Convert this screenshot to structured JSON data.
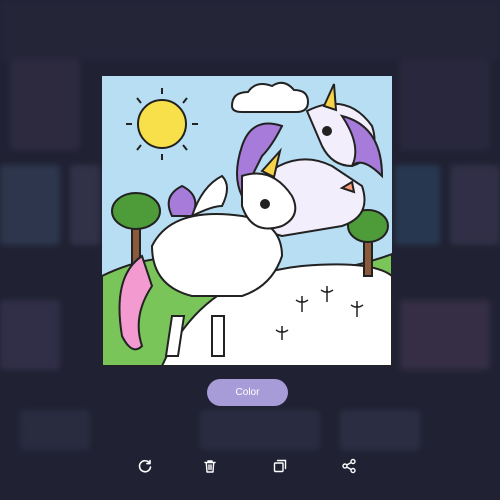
{
  "colors": {
    "background": "#26283a",
    "accent": "#a79bd8",
    "icon": "#ffffff"
  },
  "action": {
    "color_label": "Color"
  },
  "toolbar": {
    "icons": [
      "refresh-icon",
      "trash-icon",
      "duplicate-icon",
      "share-icon"
    ]
  }
}
